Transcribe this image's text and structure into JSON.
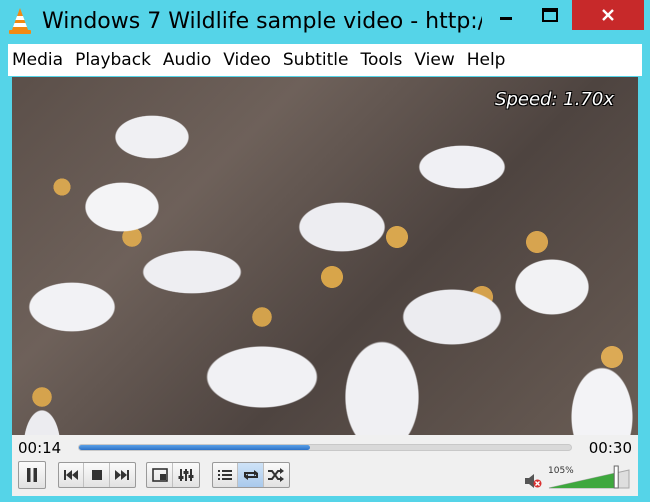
{
  "window": {
    "title": "Windows 7 Wildlife sample video - http://...",
    "app_icon": "vlc-cone-icon",
    "buttons": {
      "minimize": "minimize-icon",
      "maximize": "maximize-icon",
      "close": "close-icon"
    }
  },
  "menu": {
    "items": [
      "Media",
      "Playback",
      "Audio",
      "Video",
      "Subtitle",
      "Tools",
      "View",
      "Help"
    ]
  },
  "video": {
    "osd_text": "Speed: 1.70x"
  },
  "controls": {
    "time_elapsed": "00:14",
    "time_total": "00:30",
    "seek_progress_fraction": 0.47,
    "volume_label": "105%",
    "volume_level_percent": 105,
    "buttons": [
      "pause-icon",
      "previous-icon",
      "stop-icon",
      "next-icon",
      "fullscreen-icon",
      "extended-settings-icon",
      "playlist-icon",
      "loop-icon",
      "random-icon"
    ],
    "colors": {
      "accent": "#2c72c8",
      "close_button": "#c7292a",
      "window_frame": "#55d4e8"
    }
  }
}
